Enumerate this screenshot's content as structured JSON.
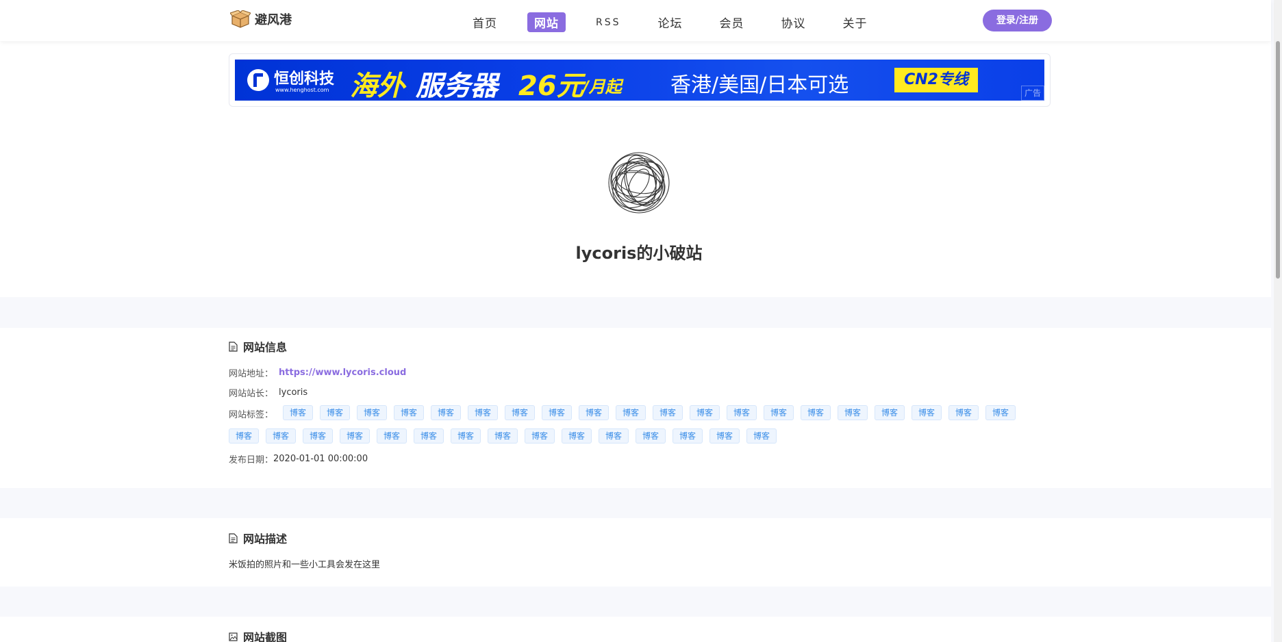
{
  "header": {
    "logo_text": "避风港",
    "nav": [
      {
        "label": "首页",
        "active": false
      },
      {
        "label": "网站",
        "active": true
      },
      {
        "label": "RSS",
        "active": false
      },
      {
        "label": "论坛",
        "active": false
      },
      {
        "label": "会员",
        "active": false
      },
      {
        "label": "协议",
        "active": false
      },
      {
        "label": "关于",
        "active": false
      }
    ],
    "login_label": "登录/注册"
  },
  "banner": {
    "brand": "恒创科技",
    "brand_url": "www.henghost.com",
    "headline_yellow": "海外",
    "headline_white": "服务器",
    "price": "26元",
    "unit": "/月起",
    "regions": "香港/美国/日本可选",
    "badge": "CN2专线",
    "ad_label": "广告"
  },
  "site": {
    "title": "lycoris的小破站"
  },
  "info": {
    "section_title": "网站信息",
    "url_label": "网站地址：",
    "url": "https://www.lycoris.cloud",
    "owner_label": "网站站长：",
    "owner": "lycoris",
    "tags_label": "网站标签：",
    "tags": [
      "博客",
      "博客",
      "博客",
      "博客",
      "博客",
      "博客",
      "博客",
      "博客",
      "博客",
      "博客",
      "博客",
      "博客",
      "博客",
      "博客",
      "博客",
      "博客",
      "博客",
      "博客",
      "博客",
      "博客",
      "博客",
      "博客",
      "博客",
      "博客",
      "博客",
      "博客",
      "博客",
      "博客",
      "博客",
      "博客",
      "博客",
      "博客",
      "博客",
      "博客",
      "博客"
    ],
    "date_label": "发布日期：",
    "date": "2020-01-01 00:00:00"
  },
  "description": {
    "section_title": "网站描述",
    "text": "米饭拍的照片和一些小工具会发在这里"
  },
  "screenshot": {
    "section_title": "网站截图"
  },
  "colors": {
    "accent": "#8a6ce0",
    "tag_text": "#3d8fe8",
    "banner_blue": "#0033d6",
    "banner_yellow": "#ffea1f"
  }
}
